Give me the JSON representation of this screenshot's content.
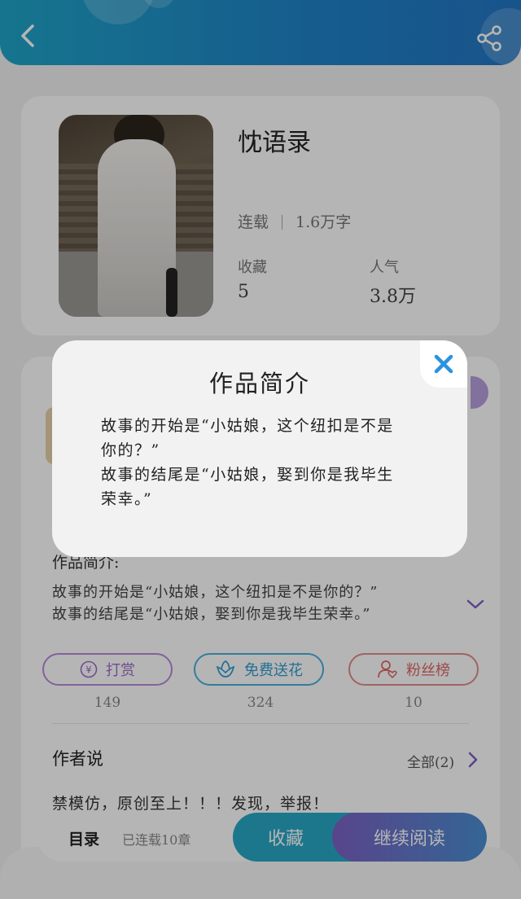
{
  "header": {
    "back_icon": "chevron-left-icon",
    "share_icon": "share-icon"
  },
  "book": {
    "title": "忱语录",
    "status": "连载",
    "word_count": "1.6万字",
    "favorites_label": "收藏",
    "favorites_value": "5",
    "popularity_label": "人气",
    "popularity_value": "3.8万"
  },
  "intro": {
    "label": "作品简介:",
    "line1": "故事的开始是“小姑娘，这个纽扣是不是你的？”",
    "line2": "故事的结尾是“小姑娘，娶到你是我毕生荣幸。”"
  },
  "actions": [
    {
      "label": "打赏",
      "count": "149",
      "icon": "yen-icon"
    },
    {
      "label": "免费送花",
      "count": "324",
      "icon": "flower-icon"
    },
    {
      "label": "粉丝榜",
      "count": "10",
      "icon": "user-heart-icon"
    }
  ],
  "author": {
    "label": "作者说",
    "all_label": "全部(2)",
    "text": "禁模仿，原创至上！！！发现，举报！"
  },
  "bottom_bar": {
    "toc_label": "目录",
    "serial_label": "已连载10章",
    "collect_label": "收藏",
    "read_label": "继续阅读"
  },
  "modal": {
    "title": "作品简介",
    "lines": [
      "故事的开始是“小姑娘，这个纽扣是不是",
      "你的？”",
      "故事的结尾是“小姑娘，娶到你是我毕生",
      "荣幸。”"
    ]
  },
  "colors": {
    "header_accent": "#2083c9",
    "close_icon": "#2b93e0",
    "reward": "#9d6ccc",
    "flower": "#2f9dd0",
    "fans": "#de6666"
  }
}
